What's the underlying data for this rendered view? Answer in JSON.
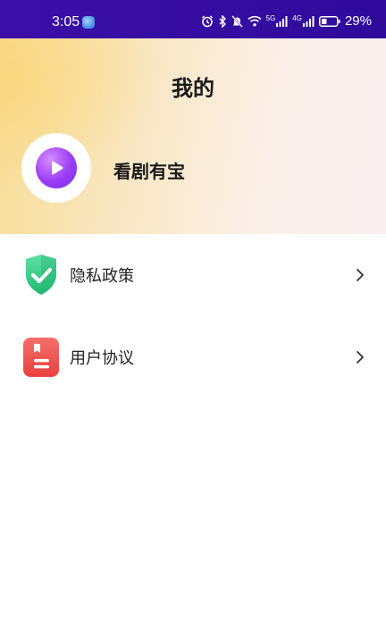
{
  "status_bar": {
    "time": "3:05",
    "battery_percent": "29%",
    "network_1": "5G",
    "network_2": "4G"
  },
  "header": {
    "title": "我的"
  },
  "profile": {
    "app_name": "看剧有宝",
    "avatar_icon": "play-icon"
  },
  "menu": {
    "items": [
      {
        "label": "隐私政策",
        "icon": "shield-check-icon"
      },
      {
        "label": "用户协议",
        "icon": "document-icon"
      }
    ]
  },
  "colors": {
    "status_bar": "#3c0fa8",
    "header_gradient_start": "#f8dc93",
    "header_gradient_end": "#fbeef0",
    "shield": "#3ecf8e",
    "document": "#f0524f",
    "avatar_accent": "#9b3cf5"
  }
}
